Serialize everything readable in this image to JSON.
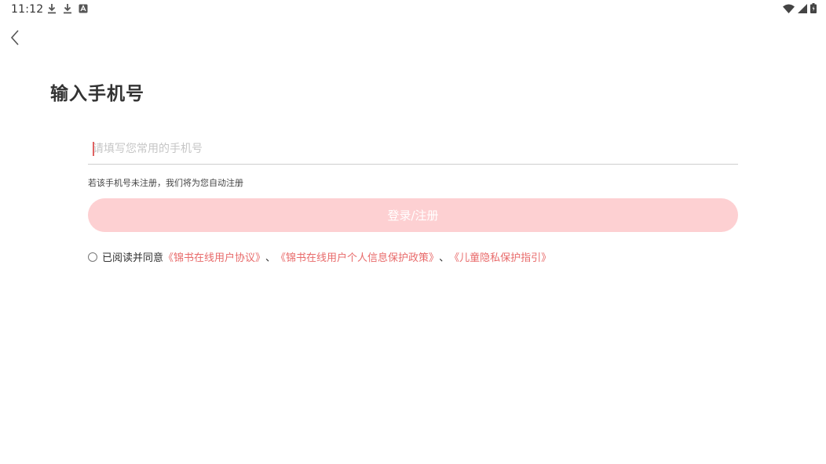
{
  "status_bar": {
    "time": "11:12",
    "left_icons": [
      "download-icon",
      "download-icon",
      "app-notification-icon"
    ],
    "right_icons": [
      "wifi-icon",
      "signal-icon",
      "battery-icon"
    ]
  },
  "header": {
    "back_icon": "chevron-left-icon"
  },
  "page": {
    "title": "输入手机号"
  },
  "form": {
    "phone_value": "",
    "phone_placeholder": "请填写您常用的手机号",
    "hint": "若该手机号未注册，我们将为您自动注册",
    "login_label": "登录/注册"
  },
  "agreement": {
    "prefix": "已阅读并同意",
    "link_1": "《锦书在线用户协议》",
    "sep_1": "、",
    "link_2": "《锦书在线用户个人信息保护政策》",
    "sep_2": "、",
    "link_3": "《儿童隐私保护指引》"
  },
  "colors": {
    "accent": "#e86a6a",
    "button_bg": "#fdd0d2",
    "text": "#333333",
    "placeholder": "#c6c6c6"
  }
}
